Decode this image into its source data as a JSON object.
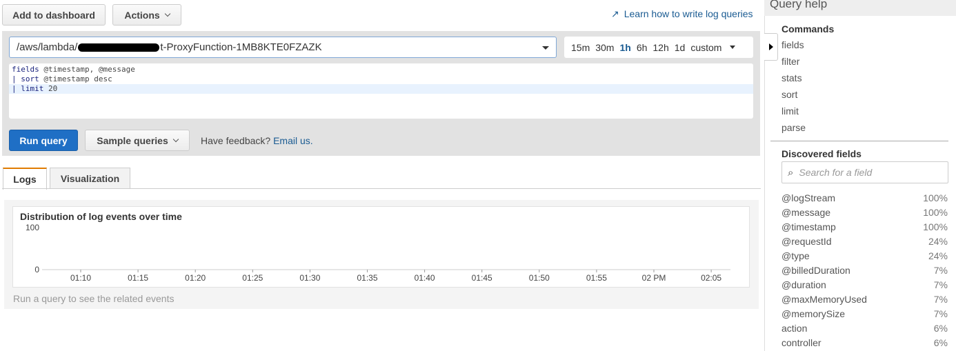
{
  "toolbar": {
    "add_dashboard": "Add to dashboard",
    "actions": "Actions",
    "learn_link": "Learn how to write log queries"
  },
  "log_group": {
    "prefix": "/aws/lambda/",
    "suffix": "t-ProxyFunction-1MB8KTE0FZAZK"
  },
  "time_range": {
    "options": [
      "15m",
      "30m",
      "1h",
      "6h",
      "12h",
      "1d",
      "custom"
    ],
    "active": "1h"
  },
  "query": {
    "lines": [
      [
        "fields",
        " @timestamp, @message"
      ],
      [
        "| sort",
        " @timestamp desc"
      ],
      [
        "| limit",
        " 20"
      ]
    ]
  },
  "actions": {
    "run": "Run query",
    "sample": "Sample queries",
    "feedback": "Have feedback?",
    "email": "Email us."
  },
  "tabs": [
    "Logs",
    "Visualization"
  ],
  "chart_data": {
    "type": "bar",
    "title": "Distribution of log events over time",
    "y_ticks": [
      "100",
      "0"
    ],
    "ylim": [
      0,
      100
    ],
    "x_ticks": [
      "01:10",
      "01:15",
      "01:20",
      "01:25",
      "01:30",
      "01:35",
      "01:40",
      "01:45",
      "01:50",
      "01:55",
      "02 PM",
      "02:05"
    ],
    "values": [],
    "empty_message": "Run a query to see the related events"
  },
  "help": {
    "title": "Query help",
    "commands_title": "Commands",
    "commands": [
      "fields",
      "filter",
      "stats",
      "sort",
      "limit",
      "parse"
    ],
    "fields_title": "Discovered fields",
    "search_placeholder": "Search for a field",
    "fields": [
      [
        "@logStream",
        "100%"
      ],
      [
        "@message",
        "100%"
      ],
      [
        "@timestamp",
        "100%"
      ],
      [
        "@requestId",
        "24%"
      ],
      [
        "@type",
        "24%"
      ],
      [
        "@billedDuration",
        "7%"
      ],
      [
        "@duration",
        "7%"
      ],
      [
        "@maxMemoryUsed",
        "7%"
      ],
      [
        "@memorySize",
        "7%"
      ],
      [
        "action",
        "6%"
      ],
      [
        "controller",
        "6%"
      ]
    ]
  },
  "colors": {
    "accent": "#1f6fc5",
    "link": "#1a5b92",
    "tab_active": "#e07b00"
  }
}
